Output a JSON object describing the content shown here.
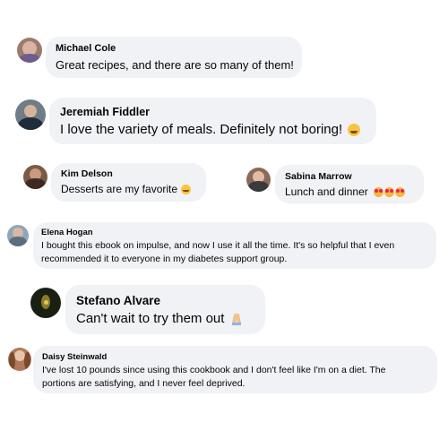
{
  "comments": [
    {
      "name": "Michael Cole",
      "text": "Great recipes, and there are so many of them!",
      "emoji": ""
    },
    {
      "name": "Jeremiah Fiddler",
      "text": "I love the variety of meals. Definitely not boring!",
      "emoji": "smiling-face-icon"
    },
    {
      "name": "Kim Delson",
      "text": "Desserts are my favorite",
      "emoji": "smiling-face-icon"
    },
    {
      "name": "Sabina Marrow",
      "text": "Lunch and dinner",
      "emoji": "heart-eyes-face-icon x3"
    },
    {
      "name": "Elena Hogan",
      "text_line1": "I bought this ebook on impulse, and now I use it all the time. It's so helpful that I even",
      "text_line2": "recommended it to everyone in my diabetes support group."
    },
    {
      "name": "Stefano Alvare",
      "text": "Can't wait to try them out",
      "emoji": "folded-hands-icon"
    },
    {
      "name": "Daisy Steinwald",
      "text_line1": "I've lost 10 pounds since using this cookbook and I don't feel like I'm on a diet. The",
      "text_line2": "portions are satisfying, and I never feel deprived."
    }
  ],
  "colors": {
    "bubble": "#f0f2f5",
    "text": "#050505",
    "emoji_yellow": "#f7c53d",
    "heart_red": "#e0245e"
  }
}
